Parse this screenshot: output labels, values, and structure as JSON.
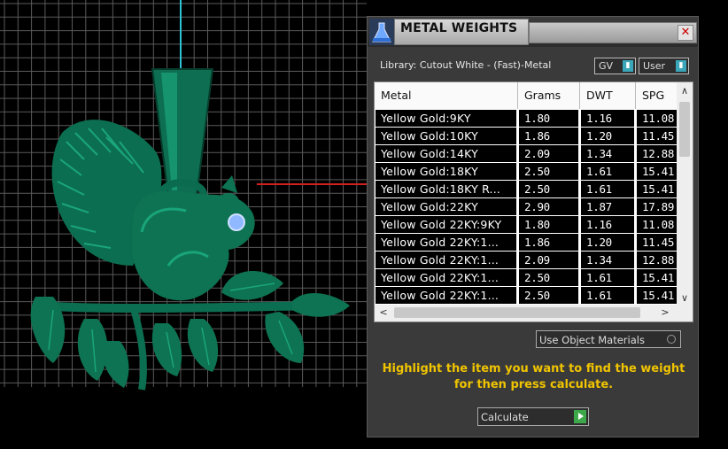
{
  "viewport": {
    "description_icon": "squirrel-pendant-3d-model",
    "colors": {
      "background": "#000000",
      "grid": "#5a5a5a",
      "model": "#0f7a5a",
      "axis_y": "#2ec4d6",
      "axis_x": "#d21f1f"
    }
  },
  "panel": {
    "title": "METAL WEIGHTS",
    "close_label": "✕",
    "library_label": "Library: Cutout White - (Fast)-Metal",
    "toggle_gv": "GV",
    "toggle_user": "User",
    "table": {
      "headers": [
        "Metal",
        "Grams",
        "DWT",
        "SPG"
      ],
      "rows": [
        [
          "Yellow Gold:9KY",
          "1.80",
          "1.16",
          "11.08"
        ],
        [
          "Yellow Gold:10KY",
          "1.86",
          "1.20",
          "11.45"
        ],
        [
          "Yellow Gold:14KY",
          "2.09",
          "1.34",
          "12.88"
        ],
        [
          "Yellow Gold:18KY",
          "2.50",
          "1.61",
          "15.41"
        ],
        [
          "Yellow Gold:18KY R...",
          "2.50",
          "1.61",
          "15.41"
        ],
        [
          "Yellow Gold:22KY",
          "2.90",
          "1.87",
          "17.89"
        ],
        [
          "Yellow Gold 22KY:9KY",
          "1.80",
          "1.16",
          "11.08"
        ],
        [
          "Yellow Gold 22KY:1...",
          "1.86",
          "1.20",
          "11.45"
        ],
        [
          "Yellow Gold 22KY:1...",
          "2.09",
          "1.34",
          "12.88"
        ],
        [
          "Yellow Gold 22KY:1...",
          "2.50",
          "1.61",
          "15.41"
        ],
        [
          "Yellow Gold 22KY:1...",
          "2.50",
          "1.61",
          "15.41"
        ]
      ]
    },
    "use_object_materials": "Use Object Materials",
    "instruction": "Highlight the item you want to find the weight for then press calculate.",
    "calculate_label": "Calculate",
    "colors": {
      "panel": "#3a3a3a",
      "instruction": "#f0c400",
      "go_button": "#3da84a",
      "toggle_knob": "#3aa6b9"
    }
  }
}
